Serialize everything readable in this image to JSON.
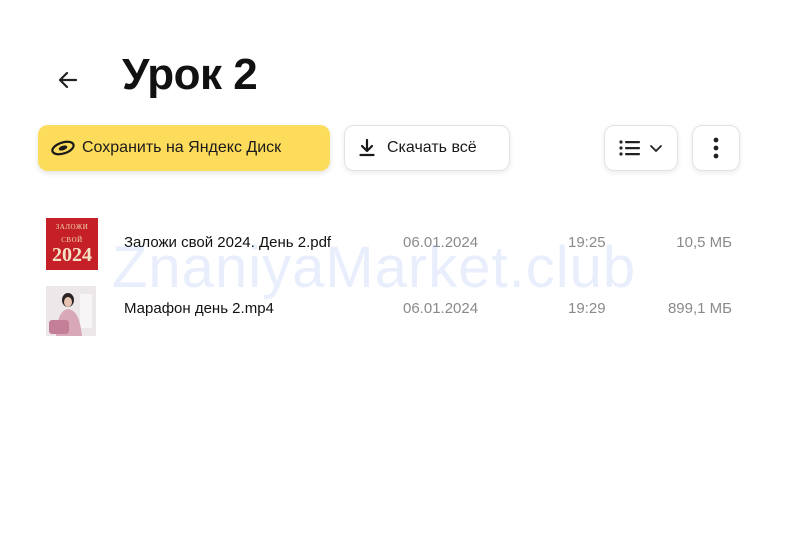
{
  "page": {
    "title": "Урок 2"
  },
  "toolbar": {
    "save_label": "Сохранить на Яндекс Диск",
    "download_label": "Скачать всё",
    "save_color": "#fedc5b"
  },
  "files": [
    {
      "name": "Заложи свой 2024. День 2.pdf",
      "date": "06.01.2024",
      "time": "19:25",
      "size": "10,5 МБ",
      "thumb_line1": "ЗАЛОЖИ",
      "thumb_line2": "СВОЙ",
      "thumb_year": "2024"
    },
    {
      "name": "Марафон день 2.mp4",
      "date": "06.01.2024",
      "time": "19:29",
      "size": "899,1 МБ"
    }
  ],
  "watermark": "ZnaniyaMarket.club",
  "icons": {
    "back": "arrow-left-icon",
    "save": "disk-icon",
    "download": "download-icon",
    "view": "list-view-icon",
    "more": "more-vertical-icon"
  }
}
